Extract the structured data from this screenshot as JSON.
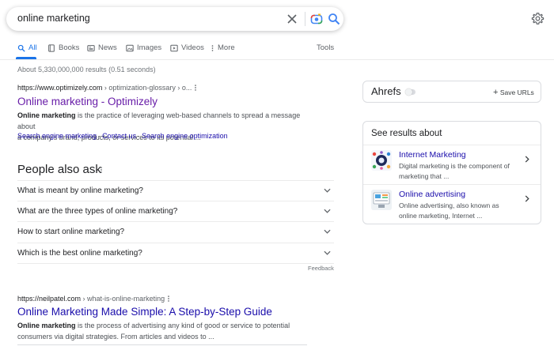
{
  "search": {
    "query": "online marketing"
  },
  "tabs": [
    {
      "label": "All",
      "icon": "search-icon",
      "active": true
    },
    {
      "label": "Books",
      "icon": "book-icon"
    },
    {
      "label": "News",
      "icon": "news-icon"
    },
    {
      "label": "Images",
      "icon": "image-icon"
    },
    {
      "label": "Videos",
      "icon": "video-icon"
    },
    {
      "label": "More",
      "icon": "more-icon"
    }
  ],
  "tools_label": "Tools",
  "stats": "About 5,330,000,000 results (0.51 seconds)",
  "results": [
    {
      "url": "https://www.optimizely.com",
      "crumb": " › optimization-glossary › o...",
      "title": "Online marketing - Optimizely",
      "snippet_bold": "Online marketing",
      "snippet_line1": " is the practice of leveraging web-based channels to spread a message about",
      "snippet_line2": "a company's brand, products, or services to its potential ...",
      "sitelinks": [
        "Search engine marketing",
        "Contact us",
        "Search engine optimization"
      ]
    },
    {
      "url": "https://neilpatel.com",
      "crumb": " › what-is-online-marketing",
      "title": "Online Marketing Made Simple: A Step-by-Step Guide",
      "snippet_bold": "Online marketing",
      "snippet_line1": " is the process of advertising any kind of good or service to potential",
      "snippet_line2": "consumers via digital strategies. From articles and videos to ..."
    }
  ],
  "sitelink_separator": "·",
  "people_also_ask": {
    "heading": "People also ask",
    "questions": [
      "What is meant by online marketing?",
      "What are the three types of online marketing?",
      "How to start online marketing?",
      "Which is the best online marketing?"
    ],
    "feedback": "Feedback"
  },
  "ahrefs": {
    "name": "Ahrefs",
    "save_label": "Save URLs",
    "enabled": false
  },
  "see_results": {
    "heading": "See results about",
    "items": [
      {
        "title": "Internet Marketing",
        "desc_line1": "Digital marketing is the component of",
        "desc_line2": "marketing that ..."
      },
      {
        "title": "Online advertising",
        "desc_line1": "Online advertising, also known as",
        "desc_line2": "online marketing, Internet ..."
      }
    ]
  },
  "colors": {
    "accent": "#1a73e8",
    "link": "#1a0dab",
    "visited": "#681da8"
  }
}
